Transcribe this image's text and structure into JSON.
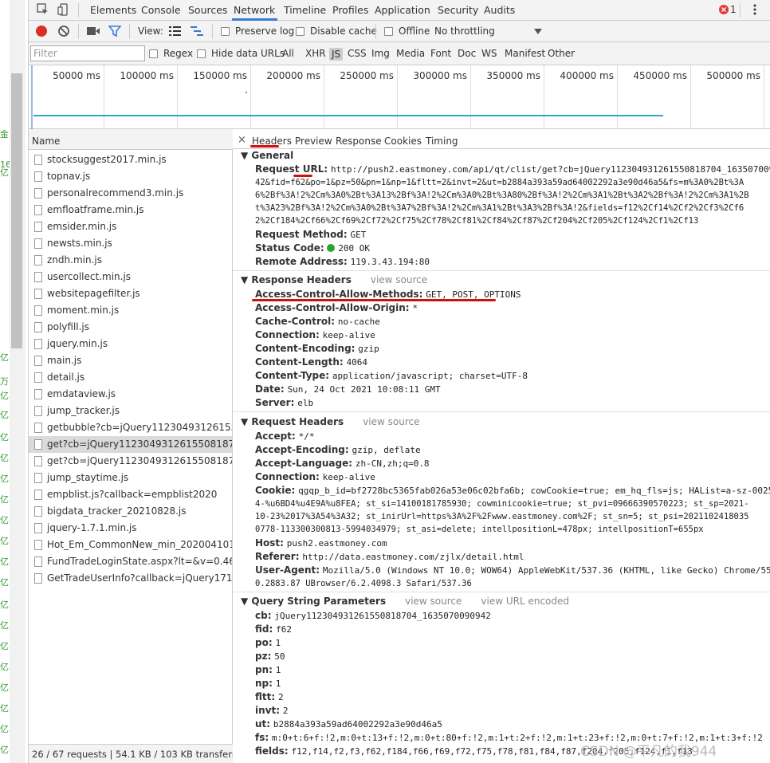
{
  "tabs": {
    "items": [
      "Elements",
      "Console",
      "Sources",
      "Network",
      "Timeline",
      "Profiles",
      "Application",
      "Security",
      "Audits"
    ],
    "active": "Network",
    "error_count": "1"
  },
  "toolbar": {
    "view_label": "View:",
    "preserve_log": "Preserve log",
    "disable_cache": "Disable cache",
    "offline": "Offline",
    "throttling": "No throttling"
  },
  "filter": {
    "placeholder": "Filter",
    "regex": "Regex",
    "hide_data_urls": "Hide data URLs",
    "types": [
      "All",
      "XHR",
      "JS",
      "CSS",
      "Img",
      "Media",
      "Font",
      "Doc",
      "WS",
      "Manifest",
      "Other"
    ],
    "active_type": "JS"
  },
  "overview": {
    "ticks": [
      "50000 ms",
      "100000 ms",
      "150000 ms",
      "200000 ms",
      "250000 ms",
      "300000 ms",
      "350000 ms",
      "400000 ms",
      "450000 ms",
      "500000 ms"
    ]
  },
  "requests": {
    "header": "Name",
    "items": [
      "stocksuggest2017.min.js",
      "topnav.js",
      "personalrecommend3.min.js",
      "emfloatframe.min.js",
      "emsider.min.js",
      "newsts.min.js",
      "zndh.min.js",
      "usercollect.min.js",
      "websitepagefilter.js",
      "moment.min.js",
      "polyfill.js",
      "jquery.min.js",
      "main.js",
      "detail.js",
      "emdataview.js",
      "jump_tracker.js",
      "getbubble?cb=jQuery112304931261550...",
      "get?cb=jQuery11230493126155081870...",
      "get?cb=jQuery11230493126155081870...",
      "jump_staytime.js",
      "empblist.js?callback=empblist2020",
      "bigdata_tracker_20210828.js",
      "jquery-1.7.1.min.js",
      "Hot_Em_CommonNew_min_2020041010...",
      "FundTradeLoginState.aspx?lt=&v=0.4600...",
      "GetTradeUserInfo?callback=jQuery17107..."
    ],
    "selected_index": 17,
    "status": "26 / 67 requests  |  54.1 KB / 103 KB transferre..."
  },
  "detail_tabs": {
    "close": "×",
    "items": [
      "Headers",
      "Preview",
      "Response",
      "Cookies",
      "Timing"
    ],
    "active": "Headers"
  },
  "general": {
    "title": "General",
    "url_label": "Request URL:",
    "url_lines": [
      "http://push2.eastmoney.com/api/qt/clist/get?cb=jQuery112304931261550818704_16350700909",
      "42&fid=f62&po=1&pz=50&pn=1&np=1&fltt=2&invt=2&ut=b2884a393a59ad64002292a3e90d46a5&fs=m%3A0%2Bt%3A",
      "6%2Bf%3A!2%2Cm%3A0%2Bt%3A13%2Bf%3A!2%2Cm%3A0%2Bt%3A80%2Bf%3A!2%2Cm%3A1%2Bt%3A2%2Bf%3A!2%2Cm%3A1%2B",
      "t%3A23%2Bf%3A!2%2Cm%3A0%2Bt%3A7%2Bf%3A!2%2Cm%3A1%2Bt%3A3%2Bf%3A!2&fields=f12%2Cf14%2Cf2%2Cf3%2Cf6",
      "2%2Cf184%2Cf66%2Cf69%2Cf72%2Cf75%2Cf78%2Cf81%2Cf84%2Cf87%2Cf204%2Cf205%2Cf124%2Cf1%2Cf13"
    ],
    "method_label": "Request Method:",
    "method": "GET",
    "status_label": "Status Code:",
    "status": "200 OK",
    "remote_label": "Remote Address:",
    "remote": "119.3.43.194:80",
    "status_color": "#2aa52a"
  },
  "response_headers": {
    "title": "Response Headers",
    "view_source": "view source",
    "items": [
      {
        "k": "Access-Control-Allow-Methods:",
        "v": "GET, POST, OPTIONS"
      },
      {
        "k": "Access-Control-Allow-Origin:",
        "v": "*"
      },
      {
        "k": "Cache-Control:",
        "v": "no-cache"
      },
      {
        "k": "Connection:",
        "v": "keep-alive"
      },
      {
        "k": "Content-Encoding:",
        "v": "gzip"
      },
      {
        "k": "Content-Length:",
        "v": "4064"
      },
      {
        "k": "Content-Type:",
        "v": "application/javascript; charset=UTF-8"
      },
      {
        "k": "Date:",
        "v": "Sun, 24 Oct 2021 10:08:11 GMT"
      },
      {
        "k": "Server:",
        "v": "elb"
      }
    ]
  },
  "request_headers": {
    "title": "Request Headers",
    "view_source": "view source",
    "accept_label": "Accept:",
    "accept": "*/*",
    "accept_encoding_label": "Accept-Encoding:",
    "accept_encoding": "gzip, deflate",
    "accept_language_label": "Accept-Language:",
    "accept_language": "zh-CN,zh;q=0.8",
    "connection_label": "Connection:",
    "connection": "keep-alive",
    "cookie_label": "Cookie:",
    "cookie_lines": [
      "qgqp_b_id=bf2728bc5365fab026a53e06c02bfa6b; cowCookie=true; em_hq_fls=js; HAList=a-sz-00259",
      "4-%u6BD4%u4E9A%u8FEA; st_si=14100181785930; cowminicookie=true; st_pvi=09666390570223; st_sp=2021-",
      "10-23%2017%3A54%3A32; st_inirUrl=https%3A%2F%2Fwww.eastmoney.com%2F; st_sn=5; st_psi=2021102418035",
      "0778-113300300813-5994034979; st_asi=delete; intellpositionL=478px; intellpositionT=655px"
    ],
    "host_label": "Host:",
    "host": "push2.eastmoney.com",
    "referer_label": "Referer:",
    "referer": "http://data.eastmoney.com/zjlx/detail.html",
    "ua_label": "User-Agent:",
    "ua_lines": [
      "Mozilla/5.0 (Windows NT 10.0; WOW64) AppleWebKit/537.36 (KHTML, like Gecko) Chrome/55.",
      "0.2883.87 UBrowser/6.2.4098.3 Safari/537.36"
    ]
  },
  "query": {
    "title": "Query String Parameters",
    "view_source": "view source",
    "view_url_encoded": "view URL encoded",
    "items": [
      {
        "k": "cb:",
        "v": "jQuery112304931261550818704_1635070090942"
      },
      {
        "k": "fid:",
        "v": "f62"
      },
      {
        "k": "po:",
        "v": "1"
      },
      {
        "k": "pz:",
        "v": "50"
      },
      {
        "k": "pn:",
        "v": "1"
      },
      {
        "k": "np:",
        "v": "1"
      },
      {
        "k": "fltt:",
        "v": "2"
      },
      {
        "k": "invt:",
        "v": "2"
      },
      {
        "k": "ut:",
        "v": "b2884a393a59ad64002292a3e90d46a5"
      },
      {
        "k": "fs:",
        "v": "m:0+t:6+f:!2,m:0+t:13+f:!2,m:0+t:80+f:!2,m:1+t:2+f:!2,m:1+t:23+f:!2,m:0+t:7+f:!2,m:1+t:3+f:!2"
      },
      {
        "k": "fields:",
        "v": "f12,f14,f2,f3,f62,f184,f66,f69,f72,f75,f78,f81,f84,f87,f204,f205,f124,f1,f13"
      }
    ]
  },
  "watermark": "CSDN @平凡的我944",
  "left_strip_fragments": [
    "金",
    "16",
    "亿",
    "亿",
    "万",
    "亿",
    "亿",
    "亿",
    "亿",
    "亿",
    "亿",
    "亿",
    "亿",
    "亿",
    "亿",
    "亿",
    "亿",
    "亿",
    "亿",
    "亿",
    "亿",
    "亿",
    "亿"
  ],
  "colors": {
    "accent": "#3879d9",
    "record": "#d93025",
    "annotation": "#d01010",
    "timeline": "#32a4d2"
  }
}
